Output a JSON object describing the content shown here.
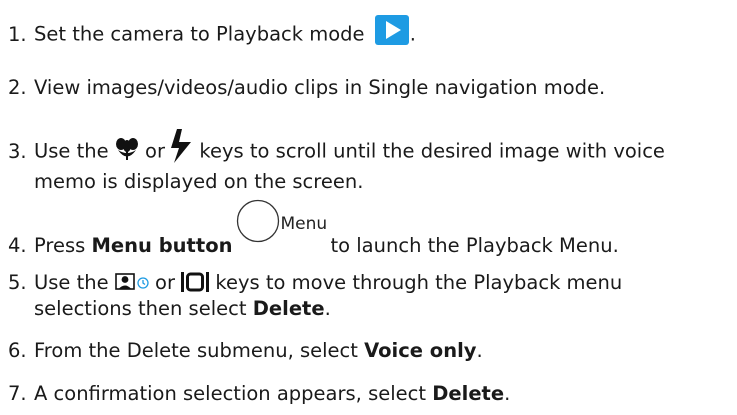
{
  "steps": [
    {
      "number": "1.",
      "before": "Set the camera to Playback mode",
      "after": ".",
      "icon": "playback-icon"
    },
    {
      "number": "2.",
      "text": "View images/videos/audio clips in Single navigation mode."
    },
    {
      "number": "3.",
      "part1": "Use the",
      "part2": "or",
      "part3": "keys to scroll until the desired image with voice",
      "line2": "memo is displayed on the screen.",
      "icons": [
        "macro-flower-icon",
        "flash-bolt-icon"
      ]
    },
    {
      "number": "4.",
      "before": "Press",
      "bold": "Menu button",
      "button_label": "Menu",
      "after": "to launch the Playback Menu."
    },
    {
      "number": "5.",
      "part1": "Use the",
      "part2": "or",
      "part3": "keys to move through the Playback menu",
      "line2_before": "selections then select",
      "line2_bold": "Delete",
      "line2_after": ".",
      "icons": [
        "face-self-timer-icon",
        "display-icon"
      ]
    },
    {
      "number": "6.",
      "before": "From the Delete submenu, select",
      "bold": "Voice only",
      "after": "."
    },
    {
      "number": "7.",
      "before": "A confirmation selection appears, select",
      "bold": "Delete",
      "after": "."
    }
  ],
  "colors": {
    "playback_icon_bg": "#1e9be3",
    "self_timer_icon": "#1e9be3",
    "text": "#1a1a1a"
  }
}
